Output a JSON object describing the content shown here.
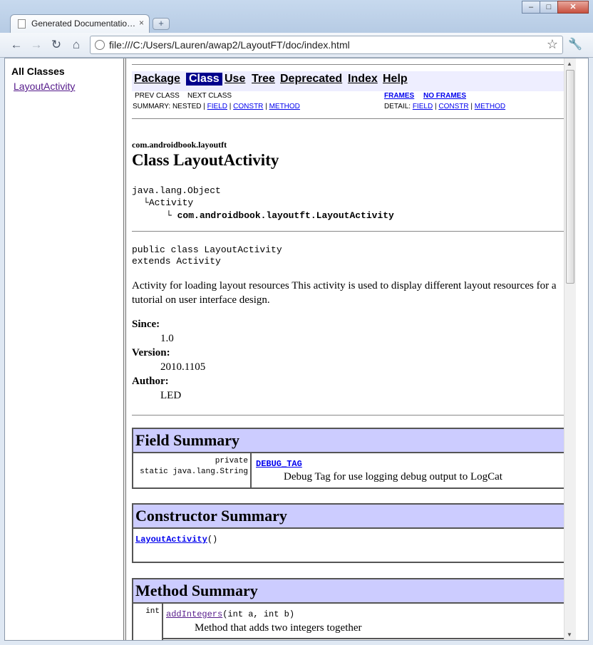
{
  "browser": {
    "tab_title": "Generated Documentatio…",
    "tab_close": "×",
    "new_tab": "+",
    "url": "file:///C:/Users/Lauren/awap2/LayoutFT/doc/index.html",
    "win_min": "–",
    "win_max": "□",
    "win_close": "✕"
  },
  "left_frame": {
    "header": "All Classes",
    "items": [
      "LayoutActivity"
    ]
  },
  "navbar": {
    "items": [
      "Package",
      "Class",
      "Use",
      "Tree",
      "Deprecated",
      "Index",
      "Help"
    ],
    "active": "Class"
  },
  "subnav": {
    "prev": "PREV CLASS",
    "next": "NEXT CLASS",
    "frames": "FRAMES",
    "no_frames": "NO FRAMES",
    "summary_label": "SUMMARY: NESTED |",
    "summary_links": [
      "FIELD",
      "CONSTR",
      "METHOD"
    ],
    "detail_label": "DETAIL:",
    "detail_links": [
      "FIELD",
      "CONSTR",
      "METHOD"
    ],
    "sep": "|"
  },
  "class_info": {
    "package": "com.androidbook.layoutft",
    "title": "Class LayoutActivity",
    "hierarchy": [
      "java.lang.Object",
      "Activity",
      "com.androidbook.layoutft.LayoutActivity"
    ],
    "declaration_1": "public class LayoutActivity",
    "declaration_2": "extends Activity",
    "description": "Activity for loading layout resources This activity is used to display different layout resources for a tutorial on user interface design.",
    "since_label": "Since:",
    "since": "1.0",
    "version_label": "Version:",
    "version": "2010.1105",
    "author_label": "Author:",
    "author": "LED"
  },
  "field_summary": {
    "title": "Field Summary",
    "modifier_1": "private",
    "modifier_2": "static java.lang.String",
    "name": "DEBUG_TAG",
    "desc": "Debug Tag for use logging debug output to LogCat"
  },
  "constructor_summary": {
    "title": "Constructor Summary",
    "name": "LayoutActivity",
    "params": "()"
  },
  "method_summary": {
    "title": "Method Summary",
    "ret": "int",
    "name": "addIntegers",
    "params": "(int a, int b)",
    "desc": "Method that adds two integers together"
  }
}
